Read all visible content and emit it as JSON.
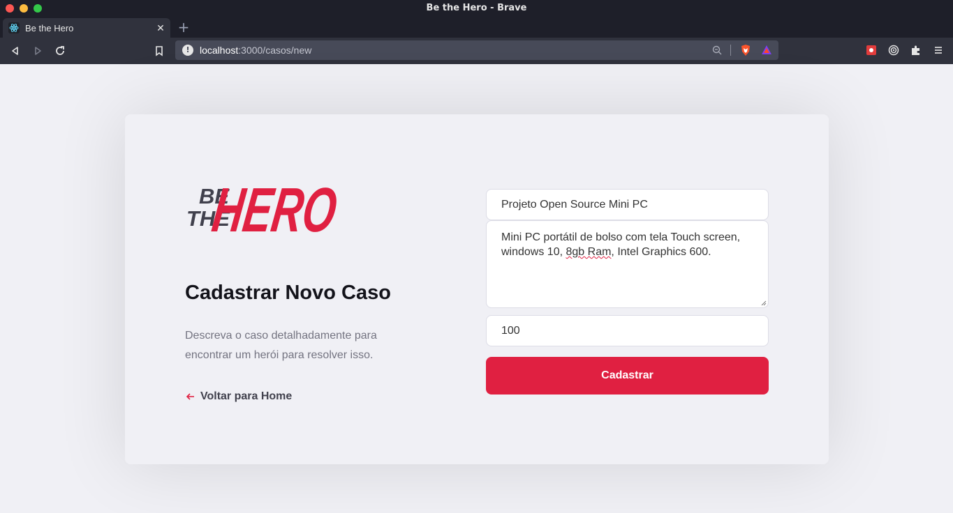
{
  "window": {
    "title": "Be the Hero - Brave"
  },
  "tabs": [
    {
      "label": "Be the Hero"
    }
  ],
  "address_bar": {
    "host": "localhost",
    "path": ":3000/casos/new"
  },
  "page": {
    "logo": {
      "small_text_line1": "BE",
      "small_text_line2": "THE",
      "big_text": "HERO"
    },
    "title": "Cadastrar Novo Caso",
    "description": "Descreva o caso detalhadamente para encontrar um herói para resolver isso.",
    "back_link": "Voltar para Home",
    "form": {
      "title_value": "Projeto Open Source Mini PC",
      "description_value_part1": "Mini PC portátil de bolso com tela Touch screen, windows 10, ",
      "description_value_misspelled": "8gb Ram",
      "description_value_part2": ", Intel Graphics 600.",
      "amount_value": "100",
      "submit_label": "Cadastrar"
    }
  },
  "colors": {
    "brand_red": "#e02041",
    "page_bg": "#f0f0f5",
    "title_text": "#13131a",
    "muted_text": "#737380"
  }
}
